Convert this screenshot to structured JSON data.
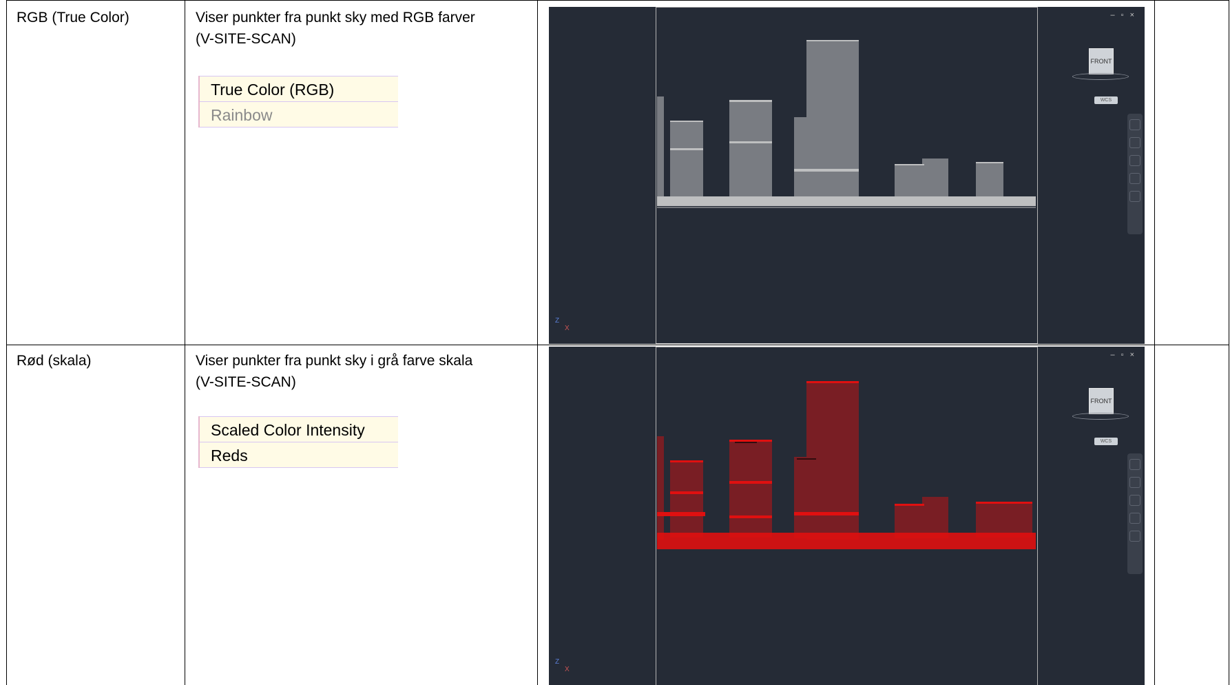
{
  "rows": [
    {
      "mode": "RGB (True Color)",
      "description_line1": "Viser punkter fra punkt sky med RGB farver",
      "description_line2": "(V-SITE-SCAN)",
      "menu_items": [
        {
          "label": "True Color (RGB)",
          "dimmed": false
        },
        {
          "label": "Rainbow",
          "dimmed": true
        }
      ],
      "viewport": {
        "window_controls": "– ▫ ×",
        "viewcube_label": "FRONT",
        "wcs_label": "WCS",
        "ucs_z": "Z",
        "ucs_x": "X",
        "point_color": "#d9d9d9"
      }
    },
    {
      "mode": "Rød (skala)",
      "description_line1": "Viser punkter fra punkt sky i grå farve skala",
      "description_line2": "(V-SITE-SCAN)",
      "menu_items": [
        {
          "label": "Scaled Color Intensity",
          "dimmed": false
        },
        {
          "label": "Reds",
          "dimmed": false
        }
      ],
      "viewport": {
        "window_controls": "– ▫ ×",
        "viewcube_label": "FRONT",
        "wcs_label": "WCS",
        "ucs_z": "Z",
        "ucs_x": "X",
        "point_color": "#e01010"
      }
    }
  ]
}
